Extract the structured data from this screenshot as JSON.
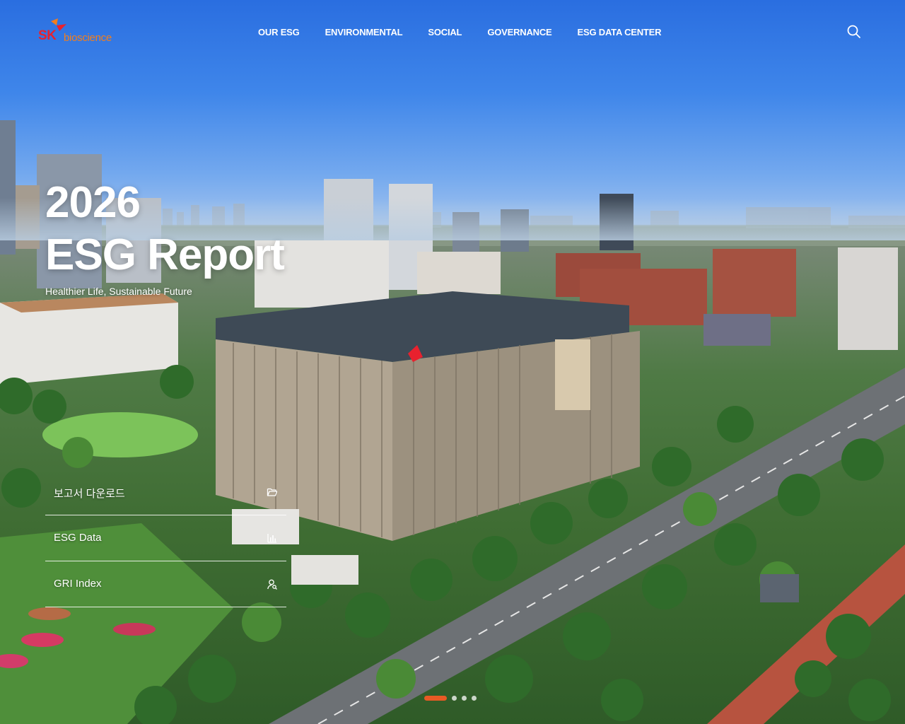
{
  "brand": {
    "sk": "SK",
    "name": "bioscience",
    "colors": {
      "sk_red": "#e8212e",
      "bio_orange": "#f27e1d"
    }
  },
  "nav": {
    "items": [
      {
        "label": "OUR ESG"
      },
      {
        "label": "ENVIRONMENTAL"
      },
      {
        "label": "SOCIAL"
      },
      {
        "label": "GOVERNANCE"
      },
      {
        "label": "ESG DATA CENTER"
      }
    ],
    "search_icon": "search-icon"
  },
  "hero": {
    "title_line1": "2026",
    "title_line2": "ESG Report",
    "subtitle": "Healthier Life, Sustainable Future"
  },
  "quick_links": [
    {
      "label": "보고서 다운로드",
      "icon": "folder-open-icon"
    },
    {
      "label": "ESG Data",
      "icon": "bar-chart-icon"
    },
    {
      "label": "GRI Index",
      "icon": "user-search-icon"
    }
  ],
  "pager": {
    "total": 4,
    "active_index": 0,
    "active_color": "#e85a24"
  }
}
